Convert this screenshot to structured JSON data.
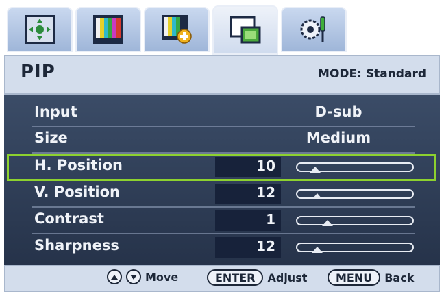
{
  "tabs": [
    {
      "icon": "picture-adjust-icon",
      "active": false
    },
    {
      "icon": "color-bars-icon",
      "active": false
    },
    {
      "icon": "picture-advanced-icon",
      "active": false
    },
    {
      "icon": "pip-icon",
      "active": true
    },
    {
      "icon": "system-settings-icon",
      "active": false
    }
  ],
  "header": {
    "title": "PIP",
    "mode": "MODE: Standard"
  },
  "rows": [
    {
      "label": "Input",
      "value": "D-sub"
    },
    {
      "label": "Size",
      "value": "Medium"
    },
    {
      "label": "H. Position",
      "value": "10",
      "level": 0.1,
      "selected": true
    },
    {
      "label": "V. Position",
      "value": "12",
      "level": 0.12
    },
    {
      "label": "Contrast",
      "value": "1",
      "level": 0.22
    },
    {
      "label": "Sharpness",
      "value": "12",
      "level": 0.12
    }
  ],
  "footer": {
    "move_label": "Move",
    "enter_label": "ENTER",
    "adjust_label": "Adjust",
    "menu_label": "MENU",
    "back_label": "Back"
  },
  "colors": {
    "selection": "#8dd12f",
    "panel": "#2f3d57",
    "header": "#d3ddec"
  }
}
